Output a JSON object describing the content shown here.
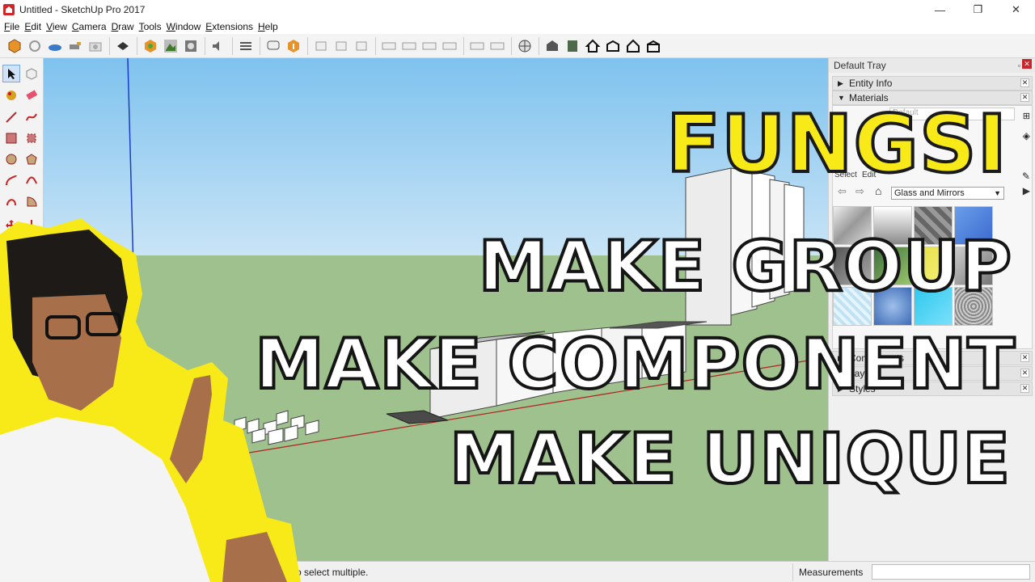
{
  "window": {
    "title": "Untitled - SketchUp Pro 2017",
    "minimize_glyph": "—",
    "maximize_glyph": "❐",
    "close_glyph": "✕"
  },
  "menu": {
    "items": [
      {
        "u": "F",
        "rest": "ile"
      },
      {
        "u": "E",
        "rest": "dit"
      },
      {
        "u": "V",
        "rest": "iew"
      },
      {
        "u": "C",
        "rest": "amera"
      },
      {
        "u": "D",
        "rest": "raw"
      },
      {
        "u": "T",
        "rest": "ools"
      },
      {
        "u": "W",
        "rest": "indow"
      },
      {
        "u": "E",
        "rest": "xtensions"
      },
      {
        "u": "H",
        "rest": "elp"
      }
    ]
  },
  "toolbar": {
    "icons": [
      "get-models-icon",
      "reload-icon",
      "share-icon",
      "sandbox-icon",
      "camera-icon",
      "geo-icon",
      "extension-warehouse-icon",
      "trimble-connect-icon",
      "photo-match-icon",
      "sound-icon",
      "layers-icon",
      "speech-icon",
      "info-icon",
      "view-iso-icon",
      "view-top-icon",
      "view-front-icon",
      "section-icon",
      "section2-icon",
      "section3-icon",
      "section4-icon",
      "style1-icon",
      "style2-icon",
      "globe-icon",
      "warehouse-box-icon",
      "book-icon",
      "home-icon",
      "house2-icon",
      "house3-icon",
      "house4-icon"
    ]
  },
  "tray": {
    "title": "Default Tray",
    "pin_glyph": "▫",
    "close_glyph": "✕",
    "panels": {
      "entity_info": "Entity Info",
      "materials": "Materials",
      "components": "Components",
      "layers": "Layers",
      "styles": "Styles"
    },
    "material_name_placeholder": "Default",
    "select_tab": "Select",
    "edit_tab": "Edit",
    "library": "Glass and Mirrors",
    "collapsed_glyph": "▶",
    "expanded_glyph": "▼"
  },
  "overlay": {
    "line1": "FUNGSI",
    "line2": "MAKE GROUP",
    "line3": "MAKE COMPONENT",
    "line4": "MAKE UNIQUE"
  },
  "status": {
    "hint": "o select multiple.",
    "measurements_label": "Measurements",
    "measurements_value": ""
  },
  "colors": {
    "sky_top": "#7ec2ee",
    "sky_bottom": "#c9e4f6",
    "ground": "#9fc18d",
    "yellow": "#f7ea18",
    "tray_bg": "#f0f0f0"
  }
}
